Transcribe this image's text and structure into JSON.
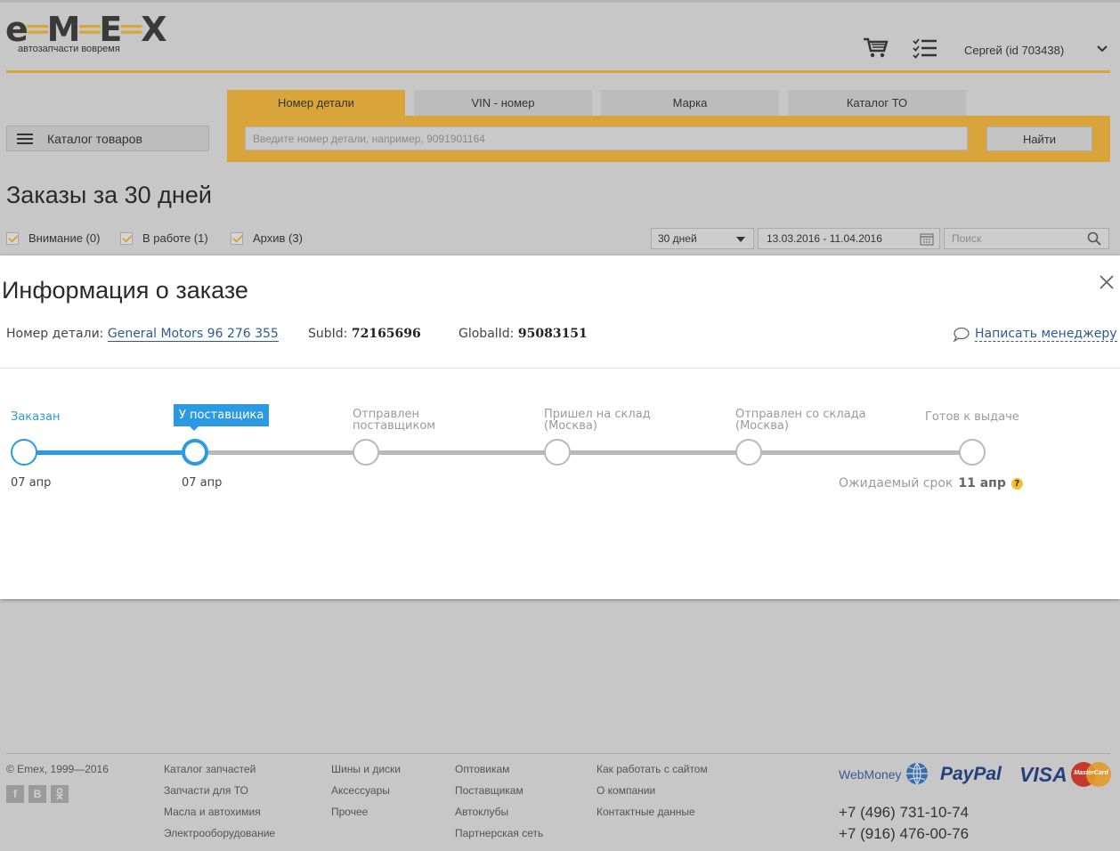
{
  "header": {
    "logo_text": "e-M-E-X",
    "logo_tagline": "автозапчасти вовремя",
    "cart_icon": "cart-icon",
    "list_icon": "checklist-icon",
    "user": "Сергей   (id 703438)"
  },
  "search": {
    "catalog_label": "Каталог товаров",
    "tabs": [
      {
        "label": "Номер детали",
        "active": true
      },
      {
        "label": "VIN - номер",
        "active": false
      },
      {
        "label": "Марка",
        "active": false
      },
      {
        "label": "Каталог ТО",
        "active": false
      }
    ],
    "placeholder": "Введите номер детали, например, 9091901164",
    "button": "Найти"
  },
  "orders": {
    "title": "Заказы за 30 дней",
    "filters": [
      {
        "label": "Внимание (0)",
        "checked": true
      },
      {
        "label": "В работе (1)",
        "checked": true
      },
      {
        "label": "Архив (3)",
        "checked": true
      }
    ],
    "period": "30 дней",
    "date_range": "13.03.2016 - 11.04.2016",
    "search_placeholder": "Поиск"
  },
  "modal": {
    "title": "Информация о заказе",
    "part_label": "Номер детали:",
    "part_value": "General Motors 96 276 355",
    "subid_label": "SubId:",
    "subid_value": "72165696",
    "globalid_label": "GlobalId:",
    "globalid_value": "95083151",
    "write_manager": "Написать менеджеру",
    "steps": [
      {
        "line1": "Заказан",
        "line2": "",
        "state": "done",
        "date": "07 апр"
      },
      {
        "line1": "У поставщика",
        "line2": "",
        "state": "current",
        "date": "07 апр"
      },
      {
        "line1": "Отправлен",
        "line2": "поставщиком",
        "state": "pending",
        "date": ""
      },
      {
        "line1": "Пришел на склад",
        "line2": "(Москва)",
        "state": "pending",
        "date": ""
      },
      {
        "line1": "Отправлен со склада",
        "line2": "(Москва)",
        "state": "pending",
        "date": ""
      },
      {
        "line1": "Готов к выдаче",
        "line2": "",
        "state": "pending",
        "date": ""
      }
    ],
    "expected_label": "Ожидаемый срок",
    "expected_value": "11 апр",
    "expected_help": "?"
  },
  "footer": {
    "copyright": "© Emex, 1999—2016",
    "socials": [
      "f",
      "B",
      "ok"
    ],
    "col1": [
      "Каталог запчастей",
      "Запчасти для ТО",
      "Масла и автохимия",
      "Электрооборудование"
    ],
    "col2": [
      "Шины и диски",
      "Аксессуары",
      "Прочее"
    ],
    "col3": [
      "Оптовикам",
      "Поставщикам",
      "Автоклубы",
      "Партнерская сеть"
    ],
    "col4": [
      "Как работать с сайтом",
      "О компании",
      "Контактные данные"
    ],
    "payments": [
      "WebMoney",
      "PayPal",
      "VISA",
      "MasterCard"
    ],
    "phone1": "+7 (496) 731-10-74",
    "phone2": "+7 (916) 476-00-76"
  },
  "colors": {
    "accent": "#d9a53a",
    "progress_blue": "#2b9ae2",
    "link": "#2f5a8f",
    "overlay_bg": "#c7c7c7"
  }
}
